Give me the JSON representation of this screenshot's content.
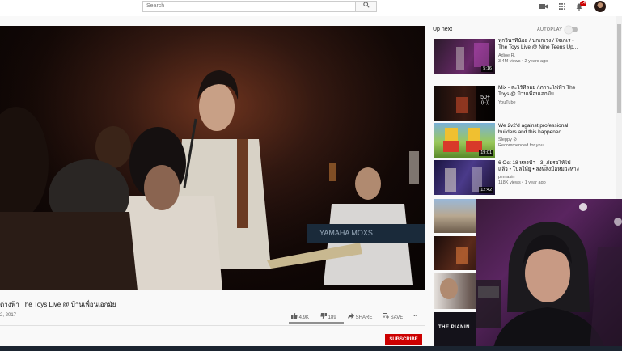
{
  "header": {
    "search_placeholder": "Search",
    "notification_count": "14"
  },
  "video": {
    "title": "ต่างฟ้า The Toys Live @ บ้านเพื่อนเอกมัย",
    "date": "2, 2017",
    "likes": "4.9K",
    "dislikes": "189",
    "share_label": "SHARE",
    "save_label": "SAVE",
    "more_label": "...",
    "subscribe_label": "SUBSCRIBE"
  },
  "upnext": {
    "heading": "Up next",
    "autoplay_label": "AUTOPLAY",
    "autoplay_on": false,
    "items": [
      {
        "title": "ทุกวินาทีน้อย / นกเกเรง / ใจเกเร - The Toys Live @ Nine Teens Up...",
        "channel": "Adjoe R.",
        "meta": "3.4M views • 2 years ago",
        "duration": "5:16",
        "thumb": "#3b1e3a"
      },
      {
        "title": "Mix - ละไร้ที่ลอย / ภาวะไพ่ฟ้า The Toys @ บ้านเพื่อนเอกมัย",
        "channel": "YouTube",
        "meta": "",
        "duration": "50+",
        "thumb": "#1a1210"
      },
      {
        "title": "We 2v2'd against professional builders and this happened...",
        "channel": "Sleppy ⊘",
        "meta": "Recommended for you",
        "duration": "19:01",
        "thumb": "#6a8a3a"
      },
      {
        "title": "6 Oct 18 หลงฟ้า - 3_ภัยรอไห้ไปแล้ว • โปลให้ยู • ลงหลังมือหมวงหางเห...",
        "channel": "pinnasin",
        "meta": "118K views • 1 year ago",
        "duration": "12:42",
        "thumb": "#2a2450"
      },
      {
        "title": "",
        "channel": "",
        "meta": "",
        "duration": "",
        "thumb": "#8a7a6a"
      },
      {
        "title": "",
        "channel": "",
        "meta": "",
        "duration": "",
        "thumb": "#3a1a12"
      },
      {
        "title": "",
        "channel": "",
        "meta": "",
        "duration": "",
        "thumb": "#5a4a44"
      },
      {
        "title": "",
        "channel": "",
        "meta": "",
        "duration": "",
        "thumb": "#14121a"
      }
    ],
    "thumb_text_8": "THE PIANIN"
  },
  "colors": {
    "subscribe_red": "#cc0000",
    "page_bg": "#f9f9f9"
  }
}
